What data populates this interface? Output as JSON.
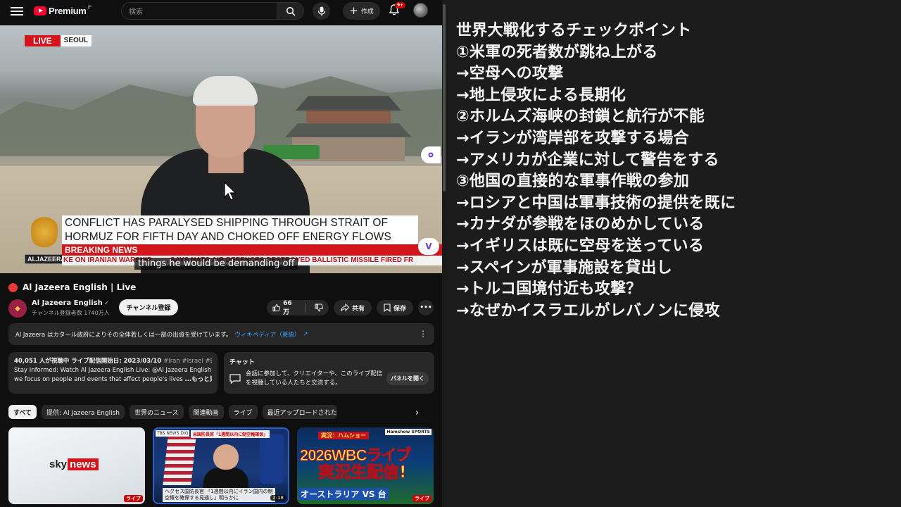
{
  "youtube": {
    "logo": {
      "word": "Premium",
      "region": "JP"
    },
    "search": {
      "placeholder": "検索"
    },
    "create_label": "作成",
    "notifications_badge": "9+",
    "video": {
      "live_label": "LIVE",
      "location": "SEOUL",
      "headline": "CONFLICT HAS PARALYSED SHIPPING THROUGH STRAIT OF HORMUZ FOR FIFTH DAY AND CHOKED OFF ENERGY FLOWS",
      "breaking": "BREAKING NEWS",
      "ticker": "KE ON IRANIAN WARSHIP — ... SAYS NATO AIR DEFENCES DESTROYED BALLISTIC MISSILE FIRED FR",
      "subtitle": "things he would be demanding off",
      "network_logo_text": "ALJAZEERA"
    },
    "title": "Al Jazeera English | Live",
    "channel": {
      "name": "Al Jazeera English",
      "subscribers": "チャンネル登録者数 1740万人",
      "subscribe_label": "チャンネル登録"
    },
    "actions": {
      "likes": "66万",
      "share": "共有",
      "save": "保存"
    },
    "notice": {
      "text": "Al Jazeera はカタール政府によりその全体若しくは一部の出資を受けています。",
      "link": "ウィキペディア（英語）"
    },
    "description": {
      "meta": "40,051 人が視聴中  ライブ配信開始日: 2023/03/10 ",
      "tags": "#Iran #Israel #B",
      "line1": "Stay Informed: Watch Al Jazeera English Live: @Al Jazeera English,",
      "line2": "we focus on people and events that affect people's lives ",
      "more": "...もっと見る"
    },
    "chat": {
      "heading": "チャット",
      "text": "会話に参加して、クリエイターや、このライブ配信を視聴している人たちと交流する。",
      "panel_button": "パネルを開く"
    },
    "chips": [
      "すべて",
      "提供: Al Jazeera English",
      "世界のニュース",
      "関連動画",
      "ライブ",
      "最近アップロードされた動画"
    ],
    "thumbnails": [
      {
        "brand": "sky",
        "brand2": "news",
        "badge": "ライブ"
      },
      {
        "tag": "TBS NEWS DIG",
        "band": "米国防長官「1週間以内に制空権確保」",
        "caption": "ヘグセス国防長官 「1週間以内にイラン国内の制空権を確保する見通し」明らかに",
        "duration": "2:18"
      },
      {
        "top": "実況：ハムショー",
        "line1": "2026WBCライブ",
        "line2": "実況生配信!",
        "vs": "オーストラリア VS 台",
        "brand": "Hamshow SPORTS",
        "badge": "ライブ"
      }
    ]
  },
  "notes": {
    "lines": [
      "世界大戦化するチェックポイント",
      "①米軍の死者数が跳ね上がる",
      "→空母への攻撃",
      "→地上侵攻による長期化",
      "②ホルムズ海峡の封鎖と航行が不能",
      "→イランが湾岸部を攻撃する場合",
      "→アメリカが企業に対して警告をする",
      "③他国の直接的な軍事作戦の参加",
      "→ロシアと中国は軍事技術の提供を既に",
      "→カナダが参戦をほのめかしている",
      "→イギリスは既に空母を送っている",
      "→スペインが軍事施設を貸出し",
      "→トルコ国境付近も攻撃？",
      "→なぜかイスラエルがレバノンに侵攻"
    ]
  },
  "colors": {
    "youtube_red": "#ff0033",
    "live_red": "#d4141b",
    "link_blue": "#3ea6ff",
    "notes_bg": "#1c1c1c",
    "page_bg": "#0f0f0f"
  }
}
